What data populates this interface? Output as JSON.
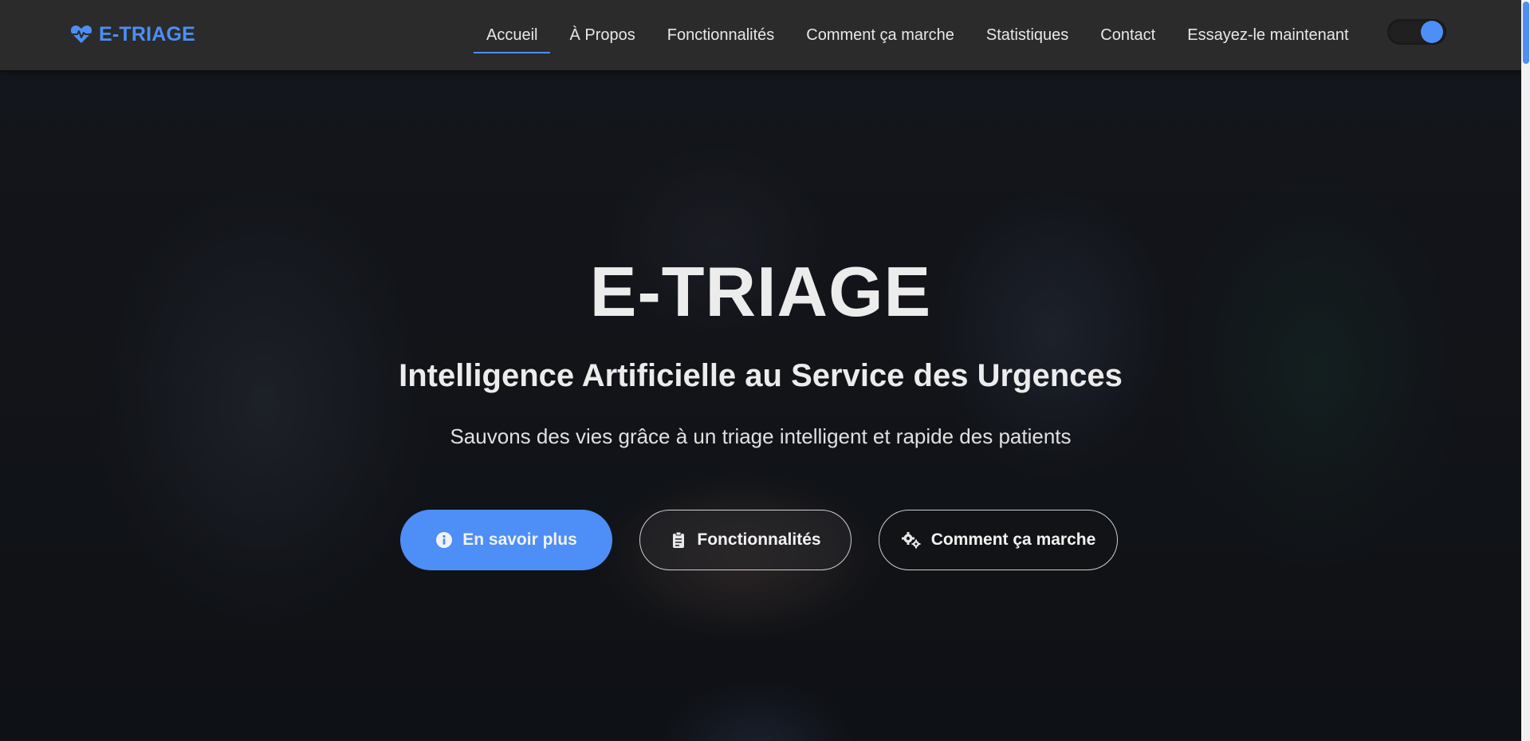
{
  "brand": {
    "name": "E-TRIAGE",
    "icon": "heart-pulse-icon"
  },
  "nav": {
    "items": [
      {
        "label": "Accueil",
        "active": true
      },
      {
        "label": "À Propos",
        "active": false
      },
      {
        "label": "Fonctionnalités",
        "active": false
      },
      {
        "label": "Comment ça marche",
        "active": false
      },
      {
        "label": "Statistiques",
        "active": false
      },
      {
        "label": "Contact",
        "active": false
      },
      {
        "label": "Essayez-le maintenant",
        "active": false
      }
    ],
    "theme_toggle": {
      "state": "on"
    }
  },
  "hero": {
    "title": "E-TRIAGE",
    "subtitle": "Intelligence Artificielle au Service des Urgences",
    "tagline": "Sauvons des vies grâce à un triage intelligent et rapide des patients",
    "buttons": [
      {
        "label": "En savoir plus",
        "icon": "info-circle-icon"
      },
      {
        "label": "Fonctionnalités",
        "icon": "clipboard-icon"
      },
      {
        "label": "Comment ça marche",
        "icon": "cogs-icon"
      }
    ]
  },
  "colors": {
    "accent": "#4d8ef7",
    "navbar_bg": "#2b2b2b",
    "text": "#ececec"
  }
}
